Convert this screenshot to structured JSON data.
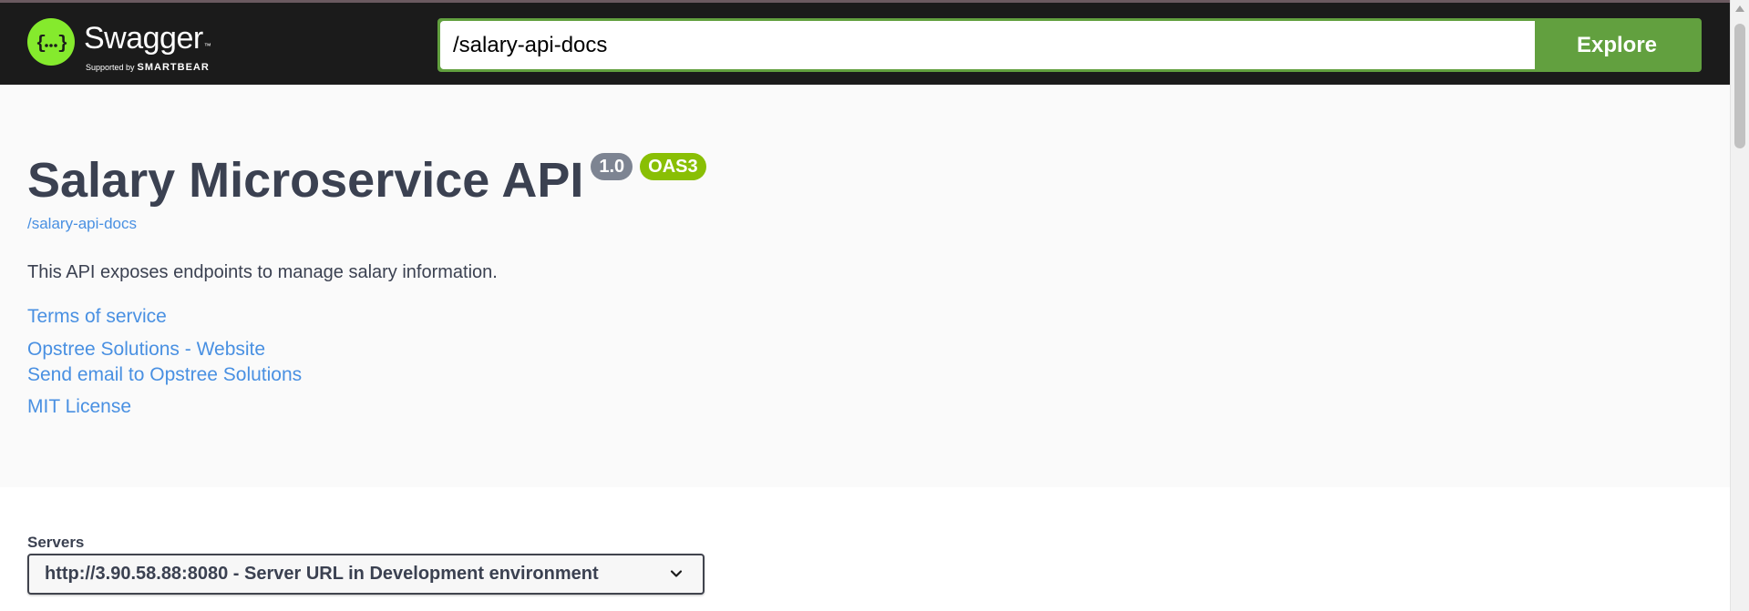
{
  "topbar": {
    "logo": {
      "title": "Swagger",
      "tm": "™",
      "supported_by": "Supported by",
      "brand": "SMARTBEAR"
    },
    "url_input_value": "/salary-api-docs",
    "explore_label": "Explore"
  },
  "info": {
    "title": "Salary Microservice API",
    "version_badge": "1.0",
    "oas_badge": "OAS3",
    "spec_url": "/salary-api-docs",
    "description": "This API exposes endpoints to manage salary information.",
    "links": {
      "terms": "Terms of service",
      "website": "Opstree Solutions - Website",
      "email": "Send email to Opstree Solutions",
      "license": "MIT License"
    }
  },
  "servers": {
    "label": "Servers",
    "selected": "http://3.90.58.88:8080 - Server URL in Development environment"
  },
  "colors": {
    "topbar_bg": "#1b1b1b",
    "accent_green": "#62a03f",
    "logo_green": "#85ea2d",
    "link_blue": "#4990e2",
    "text_dark": "#3b4151",
    "badge_grey": "#7d8492",
    "badge_oas": "#89bf04"
  },
  "icons": {
    "logo": "swagger-braces-icon",
    "select_arrow": "chevron-down-icon",
    "scroll_up": "scroll-up-arrow-icon"
  }
}
